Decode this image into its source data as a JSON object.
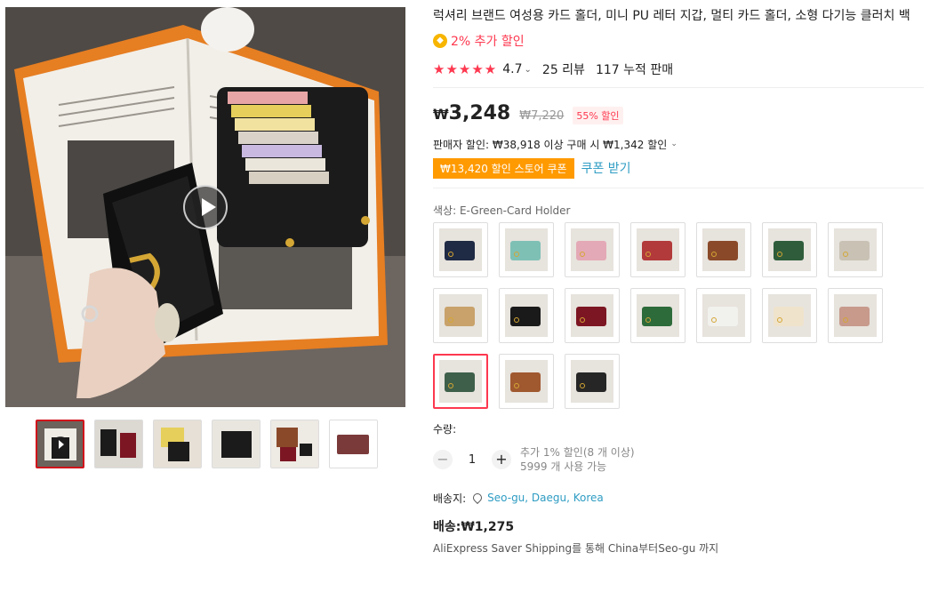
{
  "product": {
    "title": "럭셔리 브랜드 여성용 카드 홀더, 미니 PU 레터 지갑, 멀티 카드 홀더, 소형 다기능 클러치 백",
    "extra_discount": "2% 추가 할인",
    "rating": {
      "stars": "★★★★★",
      "value": "4.7",
      "reviews": "25 리뷰",
      "sold": "117 누적 판매"
    }
  },
  "price": {
    "currency": "₩",
    "current": "3,248",
    "original": "₩7,220",
    "discount": "55% 할인",
    "seller_discount": "판매자 할인: ₩38,918 이상 구매 시 ₩1,342 할인",
    "coupon": "₩13,420 할인 스토어 쿠폰",
    "coupon_action": "쿠폰 받기"
  },
  "variants": {
    "label": "색상: E-Green-Card Holder",
    "options": [
      {
        "color": "#1f2a44"
      },
      {
        "color": "#7fc0b5"
      },
      {
        "color": "#e4a9b6"
      },
      {
        "color": "#b23a3a"
      },
      {
        "color": "#8a4a2a"
      },
      {
        "color": "#2f5d3c"
      },
      {
        "color": "#c9c2b4"
      },
      {
        "color": "#c8a26a"
      },
      {
        "color": "#1a1a1a"
      },
      {
        "color": "#7c1622"
      },
      {
        "color": "#2d6b3a"
      },
      {
        "color": "#f1f1ee"
      },
      {
        "color": "#efe3cc"
      },
      {
        "color": "#c79a8c"
      },
      {
        "color": "#3e5f4a"
      },
      {
        "color": "#a0582f"
      },
      {
        "color": "#262626"
      }
    ],
    "selected_index": 14
  },
  "quantity": {
    "label": "수량:",
    "value": "1",
    "minus": "−",
    "plus": "+",
    "bulk_note": "추가 1% 할인(8 개 이상)",
    "available": "5999 개 사용 가능"
  },
  "shipping": {
    "ship_to_label": "배송지:",
    "location": "Seo-gu, Daegu, Korea",
    "cost": "배송:₩1,275",
    "method": "AliExpress Saver Shipping를 통해 China부터Seo-gu 까지"
  },
  "icons": {
    "promo": "coin-icon",
    "play": "play-icon",
    "pin": "location-pin-icon",
    "chevron": "chevron-down-icon"
  }
}
